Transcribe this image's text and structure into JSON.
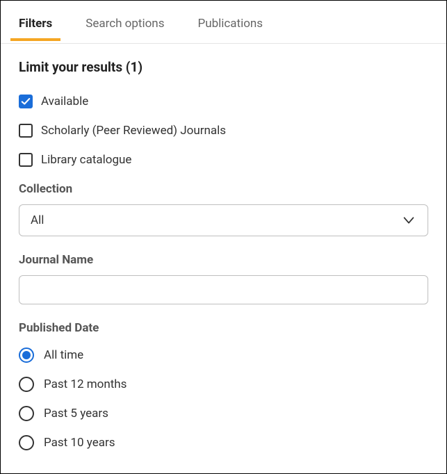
{
  "tabs": {
    "filters": "Filters",
    "search_options": "Search options",
    "publications": "Publications"
  },
  "limit_heading": "Limit your results (1)",
  "checkboxes": {
    "available": {
      "label": "Available",
      "checked": true
    },
    "scholarly": {
      "label": "Scholarly (Peer Reviewed) Journals",
      "checked": false
    },
    "library": {
      "label": "Library catalogue",
      "checked": false
    }
  },
  "collection": {
    "label": "Collection",
    "selected": "All"
  },
  "journal": {
    "label": "Journal Name",
    "value": ""
  },
  "published": {
    "label": "Published Date",
    "options": {
      "all_time": {
        "label": "All time",
        "selected": true
      },
      "past_12": {
        "label": "Past 12 months",
        "selected": false
      },
      "past_5": {
        "label": "Past 5 years",
        "selected": false
      },
      "past_10": {
        "label": "Past 10 years",
        "selected": false
      }
    }
  }
}
